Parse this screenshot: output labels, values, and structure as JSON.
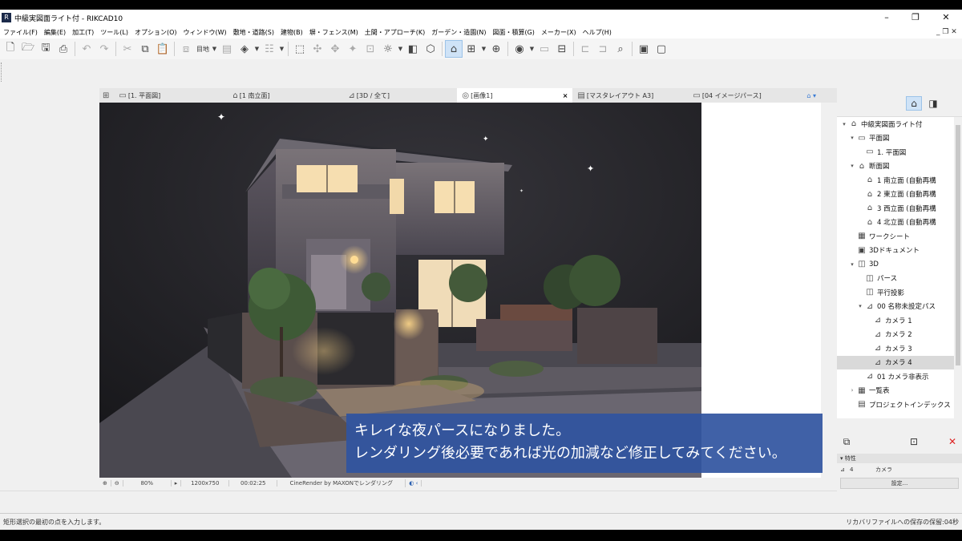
{
  "window": {
    "title": "中級実図面ライト付 - RIKCAD10",
    "app_icon": "rikcad-app-icon",
    "minimize": "–",
    "maximize": "❐",
    "close": "✕",
    "mdi_restore": "_ ❐ ✕"
  },
  "menu": {
    "items": [
      "ファイル(F)",
      "編集(E)",
      "加工(T)",
      "ツール(L)",
      "オプション(O)",
      "ウィンドウ(W)",
      "敷地・道路(S)",
      "建物(B)",
      "塀・フェンス(M)",
      "土間・アプローチ(K)",
      "ガーデン・造園(N)",
      "図面・積算(G)",
      "メーカー(X)",
      "ヘルプ(H)"
    ]
  },
  "toolbar": {
    "layer_label": "目地"
  },
  "tabs": [
    {
      "label": "[1. 平面図]",
      "icon": "floorplan-icon"
    },
    {
      "label": "[1 南立面]",
      "icon": "elevation-icon"
    },
    {
      "label": "[3D / 全て]",
      "icon": "3d-window-icon"
    },
    {
      "label": "[画像1]",
      "icon": "image-icon",
      "active": true
    },
    {
      "label": "[マスタレイアウト A3]",
      "icon": "layout-icon"
    },
    {
      "label": "[04 イメージパース]",
      "icon": "layout-icon"
    }
  ],
  "viewport_status": {
    "zoom": "80%",
    "size": "1200x750",
    "time": "00:02:25",
    "engine": "CineRender by MAXONでレンダリング"
  },
  "subtitle": {
    "line1": "キレイな夜パースになりました。",
    "line2": "レンダリング後必要であれば光の加減など修正してみてください。"
  },
  "navigator": {
    "items": [
      {
        "label": "中級実図面ライト付",
        "level": 0,
        "twisty": "▾",
        "icon": "⌂"
      },
      {
        "label": "平面図",
        "level": 1,
        "twisty": "▾",
        "icon": "▭"
      },
      {
        "label": "1. 平面図",
        "level": 2,
        "twisty": "",
        "icon": "▭"
      },
      {
        "label": "断面図",
        "level": 1,
        "twisty": "▾",
        "icon": "⌂"
      },
      {
        "label": "1 南立面 (自動再構",
        "level": 2,
        "twisty": "",
        "icon": "⌂"
      },
      {
        "label": "2 東立面 (自動再構",
        "level": 2,
        "twisty": "",
        "icon": "⌂"
      },
      {
        "label": "3 西立面 (自動再構",
        "level": 2,
        "twisty": "",
        "icon": "⌂"
      },
      {
        "label": "4 北立面 (自動再構",
        "level": 2,
        "twisty": "",
        "icon": "⌂"
      },
      {
        "label": "ワークシート",
        "level": 1,
        "twisty": "",
        "icon": "▦"
      },
      {
        "label": "3Dドキュメント",
        "level": 1,
        "twisty": "",
        "icon": "▣"
      },
      {
        "label": "3D",
        "level": 1,
        "twisty": "▾",
        "icon": "◫"
      },
      {
        "label": "パース",
        "level": 2,
        "twisty": "",
        "icon": "◫"
      },
      {
        "label": "平行投影",
        "level": 2,
        "twisty": "",
        "icon": "◫"
      },
      {
        "label": "00 名称未設定パス",
        "level": 2,
        "twisty": "▾",
        "icon": "⊿"
      },
      {
        "label": "カメラ 1",
        "level": 3,
        "twisty": "",
        "icon": "⊿"
      },
      {
        "label": "カメラ 2",
        "level": 3,
        "twisty": "",
        "icon": "⊿"
      },
      {
        "label": "カメラ 3",
        "level": 3,
        "twisty": "",
        "icon": "⊿"
      },
      {
        "label": "カメラ 4",
        "level": 3,
        "twisty": "",
        "icon": "⊿",
        "selected": true
      },
      {
        "label": "01 カメラ非表示",
        "level": 2,
        "twisty": "",
        "icon": "⊿"
      },
      {
        "label": "一覧表",
        "level": 1,
        "twisty": "›",
        "icon": "▦"
      },
      {
        "label": "プロジェクトインデックス",
        "level": 1,
        "twisty": "",
        "icon": "▤"
      }
    ]
  },
  "properties": {
    "header": "特性",
    "id": "4",
    "type": "カメラ",
    "settings_button": "設定..."
  },
  "statusbar": {
    "left": "矩形選択の最初の点を入力します。",
    "right": "リカバリファイルへの保存の保留:04秒"
  },
  "colors": {
    "subtitle_bg": "#3054a0",
    "active_tool": "#cfe3f7",
    "night_sky": "#1e1e20"
  }
}
